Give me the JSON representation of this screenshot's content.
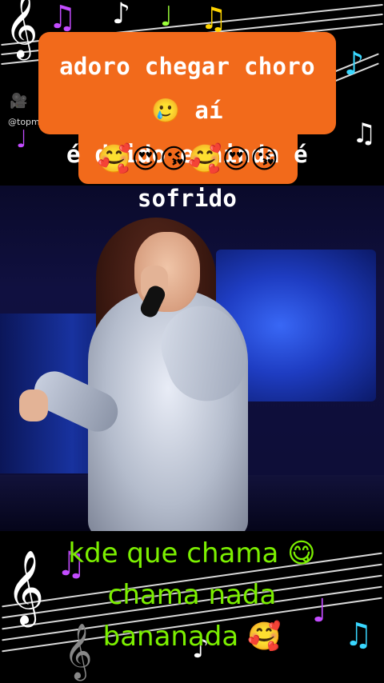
{
  "caption_top": {
    "line1": "adoro chegar choro 🥲 aí",
    "line2": "é duido e ainda é sofrido",
    "emojis": "🥰😍😘🥰😍😘"
  },
  "watermark": {
    "icon": "🎥",
    "handle": "@topm"
  },
  "caption_bottom": {
    "line1": "kde que chama 😋",
    "line2": "chama nada",
    "line3": "bananada 🥰"
  },
  "colors": {
    "caption_bg": "#f26a1b",
    "bottom_text": "#7cf000"
  },
  "icons": {
    "treble_clef": "treble-clef-icon",
    "music_note": "music-note-icon"
  }
}
